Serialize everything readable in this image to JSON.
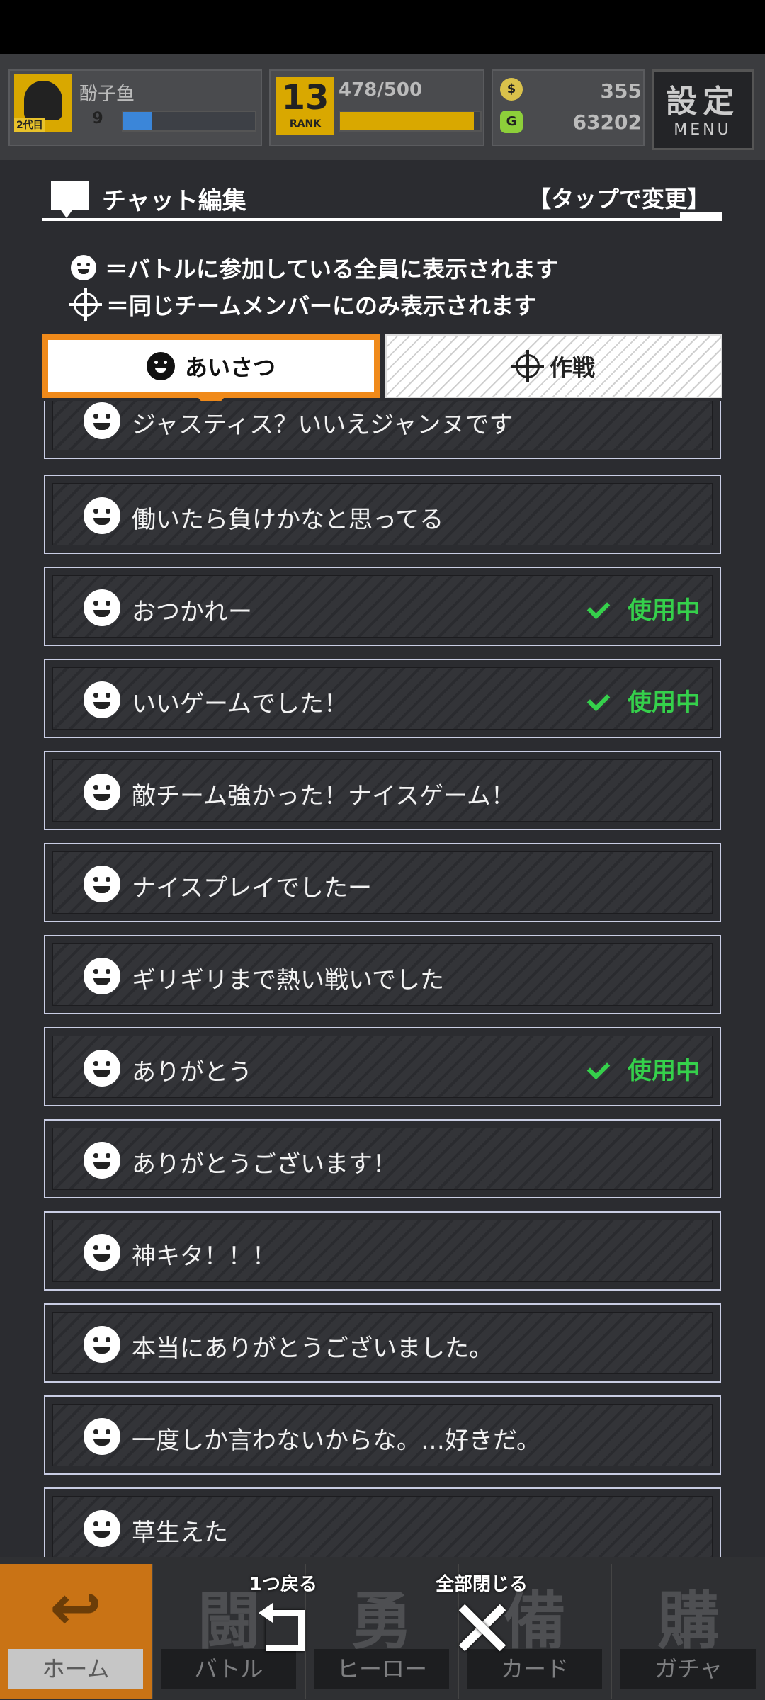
{
  "header": {
    "username": "酚子鱼",
    "level": "9",
    "level_progress": 0.22,
    "avatar_tag": "2代目",
    "rank_number": "13",
    "rank_label": "RANK",
    "stamina": "478/500",
    "stamina_progress": 0.956,
    "coin_icon": "$",
    "coins": "355",
    "gem_icon": "G",
    "gems": "63202",
    "menu_kanji": "設定",
    "menu_label": "MENU"
  },
  "panel": {
    "title": "チャット編集",
    "tap_hint": "【タップで変更】",
    "legend_all": "＝バトルに参加している全員に表示されます",
    "legend_team": "＝同じチームメンバーにのみ表示されます"
  },
  "tabs": {
    "greeting": "あいさつ",
    "tactics": "作戦"
  },
  "chat_items": [
    {
      "text": "ジャスティス？いいえジャンヌです",
      "in_use": ""
    },
    {
      "text": "働いたら負けかなと思ってる",
      "in_use": ""
    },
    {
      "text": "おつかれー",
      "in_use": "使用中"
    },
    {
      "text": "いいゲームでした！",
      "in_use": "使用中"
    },
    {
      "text": "敵チーム強かった！ナイスゲーム！",
      "in_use": ""
    },
    {
      "text": "ナイスプレイでしたー",
      "in_use": ""
    },
    {
      "text": "ギリギリまで熱い戦いでした",
      "in_use": ""
    },
    {
      "text": "ありがとう",
      "in_use": "使用中"
    },
    {
      "text": "ありがとうございます！",
      "in_use": ""
    },
    {
      "text": "神キタ！！！",
      "in_use": ""
    },
    {
      "text": "本当にありがとうございました。",
      "in_use": ""
    },
    {
      "text": "一度しか言わないからな。…好きだ。",
      "in_use": ""
    },
    {
      "text": "草生えた",
      "in_use": ""
    }
  ],
  "bottom_nav": [
    {
      "glyph": "↩",
      "label": "ホーム"
    },
    {
      "glyph": "闘",
      "label": "バトル"
    },
    {
      "glyph": "勇",
      "label": "ヒーロー"
    },
    {
      "glyph": "備",
      "label": "カード"
    },
    {
      "glyph": "購",
      "label": "ガチャ"
    }
  ],
  "overlay": {
    "back_label": "1つ戻る",
    "close_all_label": "全部閉じる"
  },
  "colors": {
    "accent_orange": "#f08a1a",
    "in_use_green": "#35d04b",
    "gold": "#d9a800"
  }
}
